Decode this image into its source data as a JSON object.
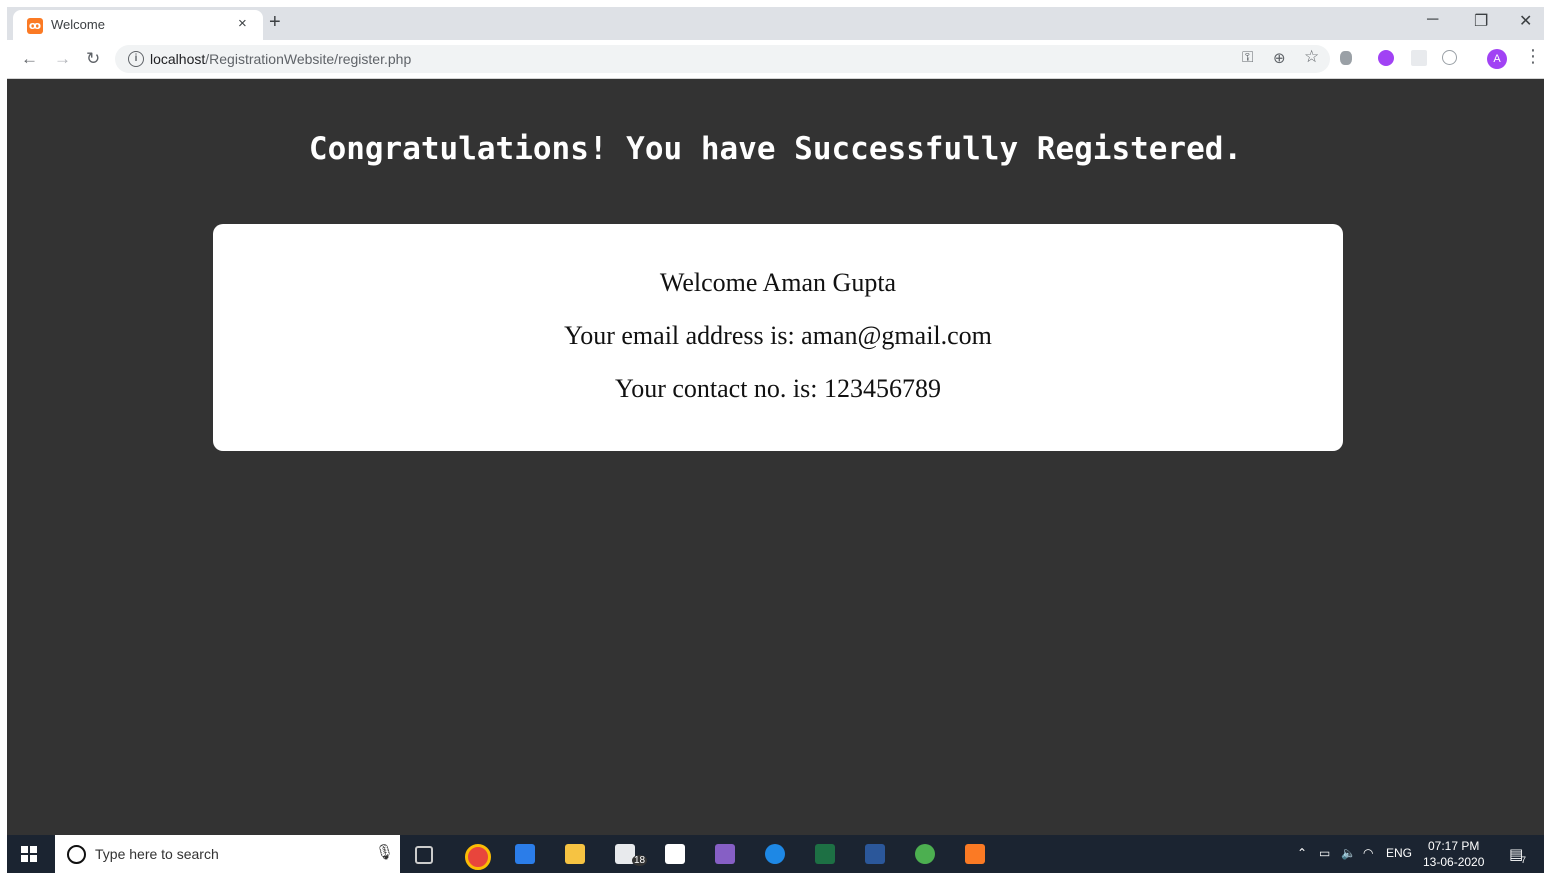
{
  "browser": {
    "tab_title": "Welcome",
    "tab_close": "×",
    "new_tab": "+",
    "url_host": "localhost",
    "url_path": "/RegistrationWebsite/register.php",
    "avatar_letter": "A"
  },
  "page": {
    "heading": "Congratulations! You have Successfully Registered.",
    "welcome_line": "Welcome Aman Gupta",
    "email_line": "Your email address is: aman@gmail.com",
    "contact_line": "Your contact no. is: 123456789"
  },
  "taskbar": {
    "search_placeholder": "Type here to search",
    "mail_badge": "18",
    "language": "ENG",
    "time": "07:17 PM",
    "date": "13-06-2020",
    "notification_count": "7"
  },
  "colors": {
    "page_bg": "#333333",
    "card_bg": "#ffffff",
    "heading_text": "#ffffff"
  }
}
